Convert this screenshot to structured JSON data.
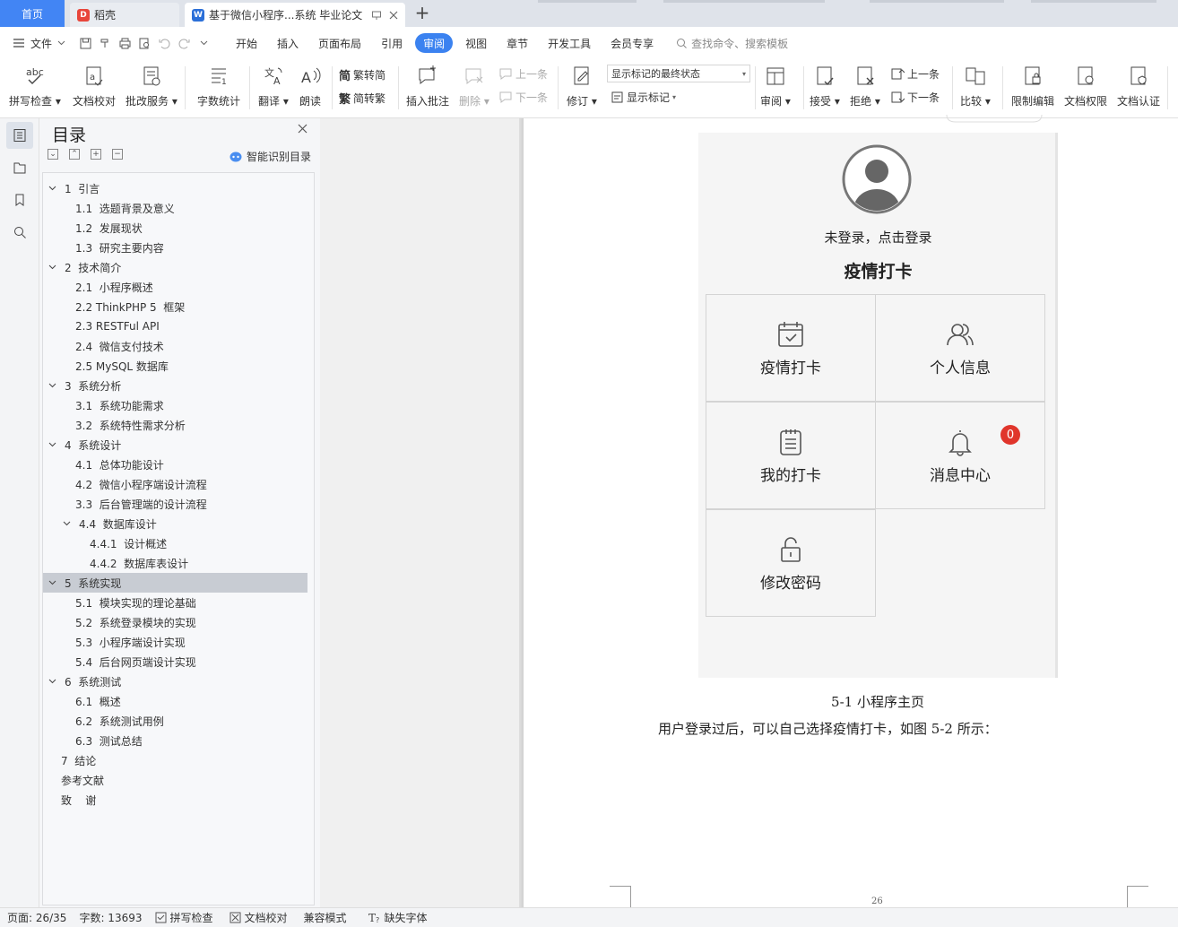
{
  "tabs": {
    "home": "首页",
    "tab1": "稻壳",
    "tab2": "基于微信小程序...系统 毕业论文"
  },
  "menu": {
    "file": "文件",
    "items": [
      "开始",
      "插入",
      "页面布局",
      "引用",
      "审阅",
      "视图",
      "章节",
      "开发工具",
      "会员专享"
    ],
    "active": "审阅",
    "search": "查找命令、搜索模板"
  },
  "ribbon": {
    "spell": "拼写检查",
    "proof": "文档校对",
    "review_service": "批改服务",
    "word_count": "字数统计",
    "translate": "翻译",
    "read": "朗读",
    "trad_simp": "繁转简",
    "simp_trad": "简转繁",
    "insert_comment": "插入批注",
    "delete": "删除",
    "prev_comment": "上一条",
    "next_comment": "下一条",
    "track": "修订",
    "display_state": "显示标记的最终状态",
    "show_markup": "显示标记",
    "review": "审阅",
    "accept": "接受",
    "reject": "拒绝",
    "prev": "上一条",
    "next": "下一条",
    "compare": "比较",
    "restrict": "限制编辑",
    "permission": "文档权限",
    "certify": "文档认证"
  },
  "toc": {
    "title": "目录",
    "ai_detect": "智能识别目录",
    "items": [
      {
        "text": "1  引言",
        "level": 1,
        "arrow": true
      },
      {
        "text": "1.1  选题背景及意义",
        "level": 2
      },
      {
        "text": "1.2  发展现状",
        "level": 2
      },
      {
        "text": "1.3  研究主要内容",
        "level": 2
      },
      {
        "text": "2  技术简介",
        "level": 1,
        "arrow": true
      },
      {
        "text": "2.1  小程序概述",
        "level": 2
      },
      {
        "text": "2.2 ThinkPHP 5  框架",
        "level": 2
      },
      {
        "text": "2.3 RESTFul API",
        "level": 2
      },
      {
        "text": "2.4  微信支付技术",
        "level": 2
      },
      {
        "text": "2.5 MySQL 数据库",
        "level": 2
      },
      {
        "text": "3  系统分析",
        "level": 1,
        "arrow": true
      },
      {
        "text": "3.1  系统功能需求",
        "level": 2
      },
      {
        "text": "3.2  系统特性需求分析",
        "level": 2
      },
      {
        "text": "4  系统设计",
        "level": 1,
        "arrow": true
      },
      {
        "text": "4.1  总体功能设计",
        "level": 2
      },
      {
        "text": "4.2  微信小程序端设计流程",
        "level": 2
      },
      {
        "text": "3.3  后台管理端的设计流程",
        "level": 2
      },
      {
        "text": "4.4  数据库设计",
        "level": 2,
        "arrow": true
      },
      {
        "text": "4.4.1  设计概述",
        "level": 3
      },
      {
        "text": "4.4.2  数据库表设计",
        "level": 3
      },
      {
        "text": "5  系统实现",
        "level": 1,
        "arrow": true,
        "selected": true
      },
      {
        "text": "5.1  模块实现的理论基础",
        "level": 2
      },
      {
        "text": "5.2  系统登录模块的实现",
        "level": 2
      },
      {
        "text": "5.3  小程序端设计实现",
        "level": 2
      },
      {
        "text": "5.4  后台网页端设计实现",
        "level": 2
      },
      {
        "text": "6  系统测试",
        "level": 1,
        "arrow": true
      },
      {
        "text": "6.1  概述",
        "level": 2
      },
      {
        "text": "6.2  系统测试用例",
        "level": 2
      },
      {
        "text": "6.3  测试总结",
        "level": 2
      },
      {
        "text": "7  结论",
        "level": 1
      },
      {
        "text": "参考文献",
        "level": 1
      },
      {
        "text": "致    谢",
        "level": 1
      }
    ]
  },
  "app": {
    "login": "未登录，点击登录",
    "title": "疫情打卡",
    "cells": [
      {
        "label": "疫情打卡",
        "icon": "calendar-check-icon"
      },
      {
        "label": "个人信息",
        "icon": "users-icon"
      },
      {
        "label": "我的打卡",
        "icon": "clipboard-list-icon"
      },
      {
        "label": "消息中心",
        "icon": "bell-icon",
        "badge": "0"
      },
      {
        "label": "修改密码",
        "icon": "lock-icon"
      }
    ]
  },
  "document": {
    "caption": "5-1  小程序主页",
    "paragraph": "用户登录过后，可以自己选择疫情打卡，如图 5-2 所示：",
    "page_number": "26"
  },
  "status": {
    "page": "页面: 26/35",
    "words": "字数: 13693",
    "spell": "拼写检查",
    "proof": "文档校对",
    "compat": "兼容模式",
    "missing_font": "缺失字体"
  },
  "colors": {
    "accent": "#3b82f0",
    "home_tab": "#4285f4",
    "badge": "#e0352b"
  }
}
